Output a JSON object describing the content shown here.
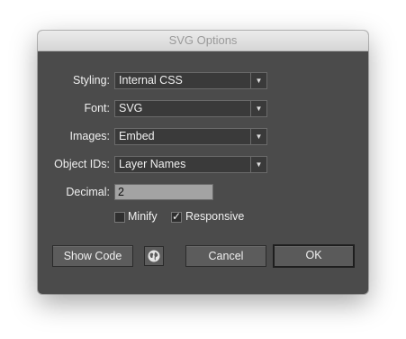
{
  "window": {
    "title": "SVG Options"
  },
  "styling": {
    "label": "Styling:",
    "value": "Internal CSS"
  },
  "font": {
    "label": "Font:",
    "value": "SVG"
  },
  "images": {
    "label": "Images:",
    "value": "Embed"
  },
  "object_ids": {
    "label": "Object IDs:",
    "value": "Layer Names"
  },
  "decimal": {
    "label": "Decimal:",
    "value": "2"
  },
  "minify": {
    "label": "Minify",
    "checked": false
  },
  "responsive": {
    "label": "Responsive",
    "checked": true
  },
  "buttons": {
    "show_code": "Show Code",
    "cancel": "Cancel",
    "ok": "OK"
  },
  "icons": {
    "dropdown": "triangle-down-icon",
    "web": "globe-icon"
  },
  "colors": {
    "panel": "#4b4b4b",
    "titlebar": "#dcdcdc",
    "field": "#3a3a3a",
    "text": "#f0f0f0"
  }
}
